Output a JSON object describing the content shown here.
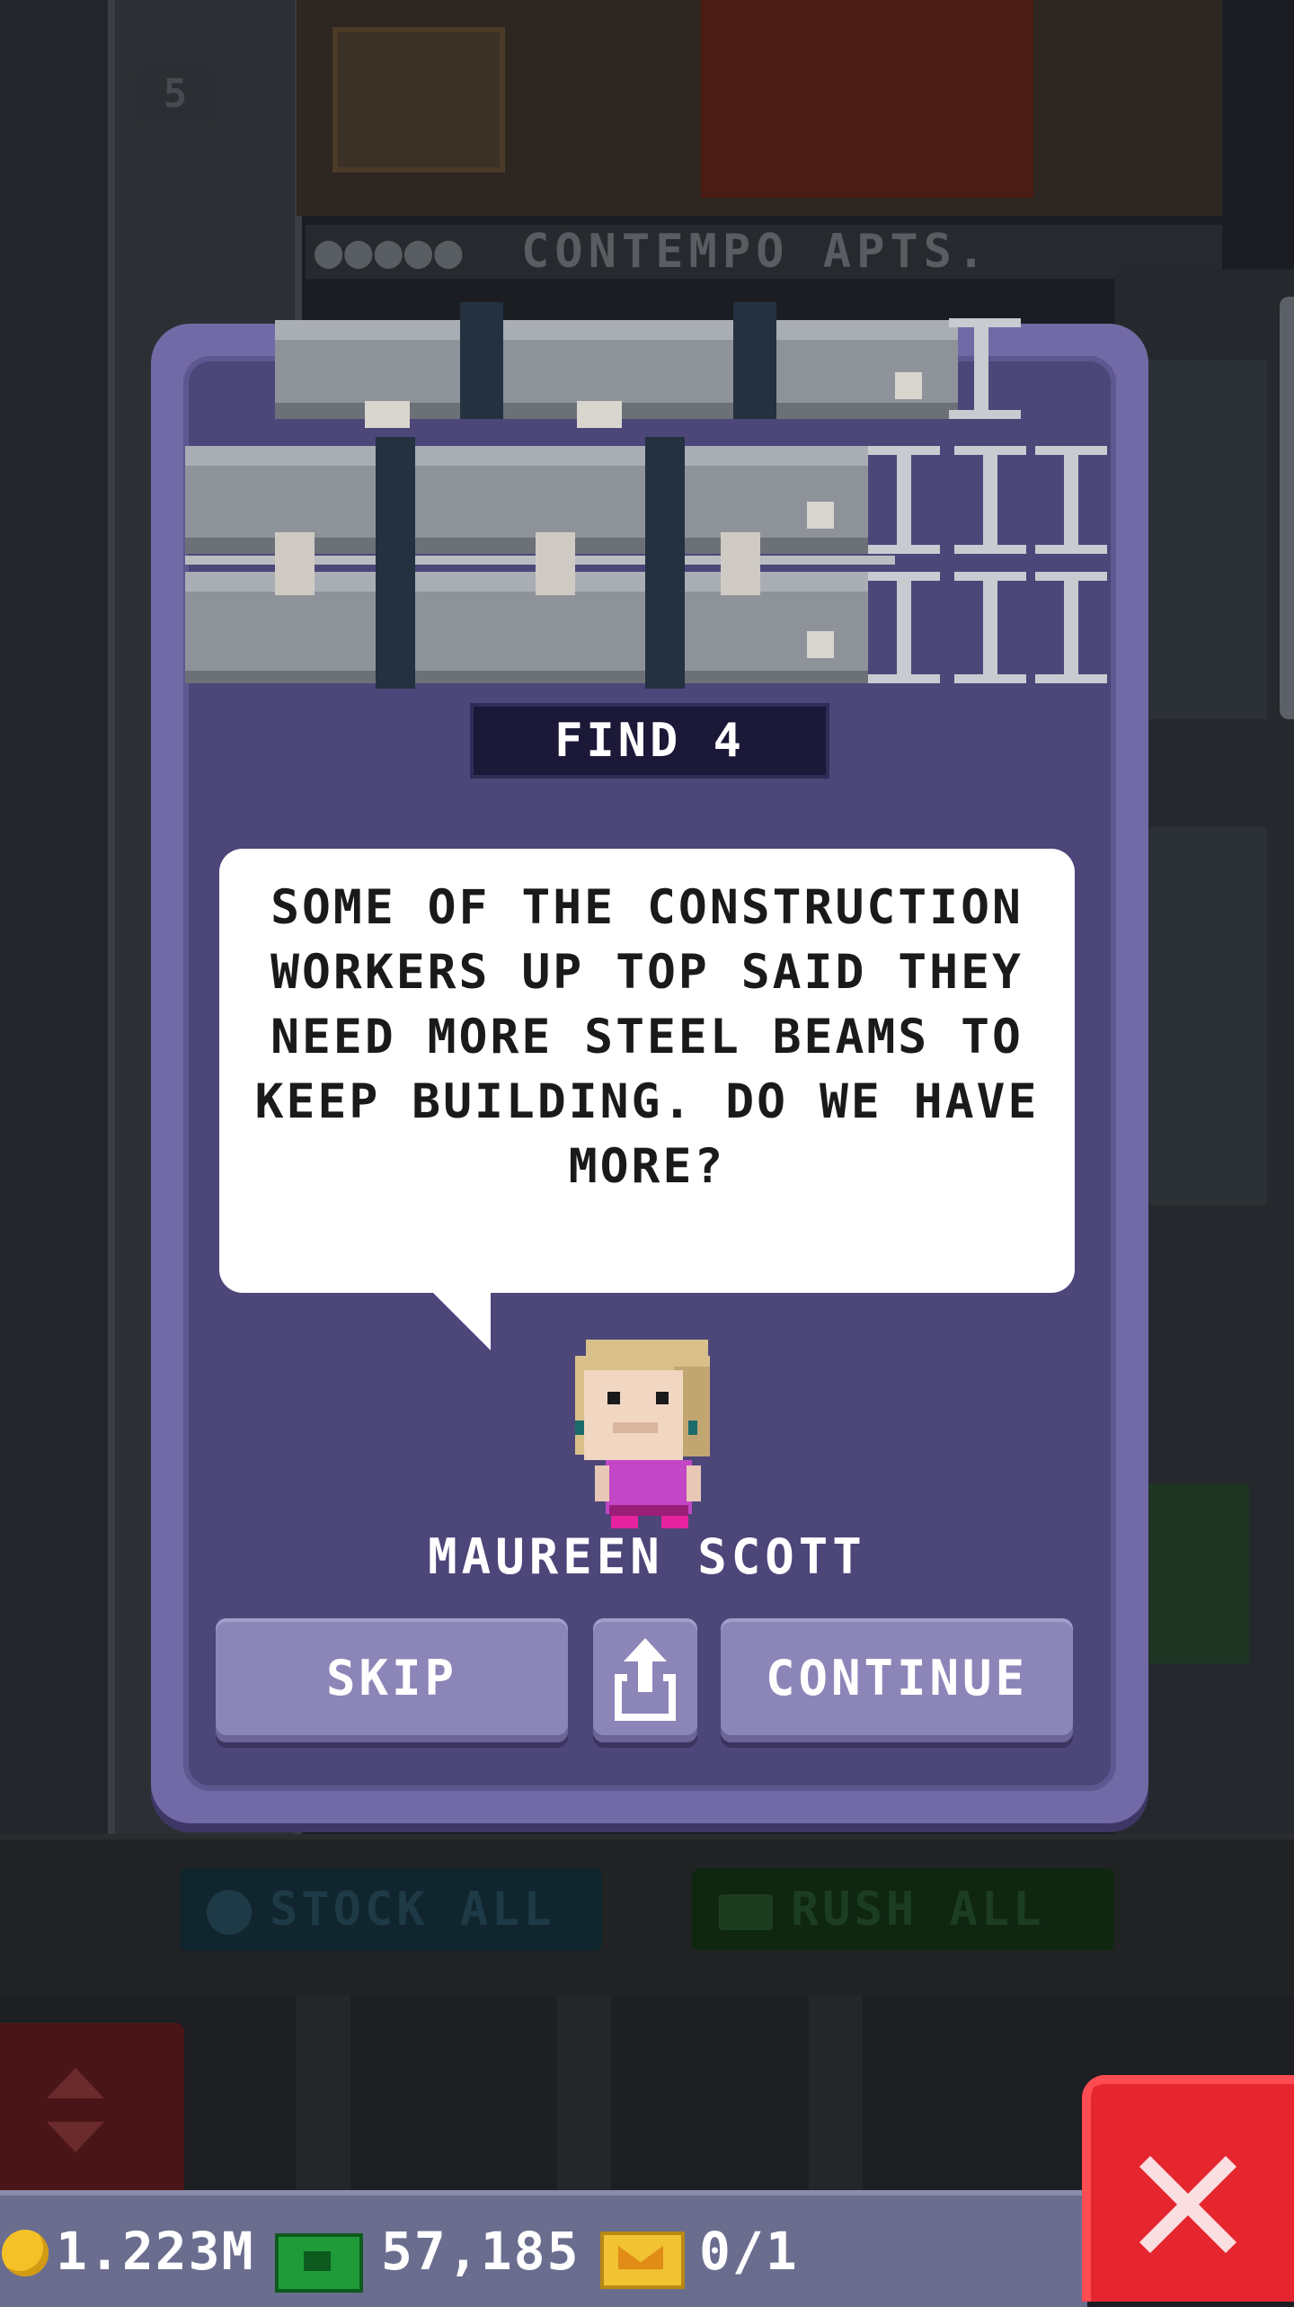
{
  "background": {
    "floor_number": "5",
    "floor_name": "CONTEMPO APTS.",
    "stock_all_label": "STOCK ALL",
    "rush_all_label": "RUSH ALL"
  },
  "mission": {
    "find_label": "FIND 4",
    "message": "SOME OF THE CONSTRUCTION WORKERS UP TOP SAID THEY NEED MORE STEEL BEAMS TO KEEP BUILDING. DO WE HAVE MORE?",
    "character_name": "MAUREEN SCOTT",
    "skip_label": "SKIP",
    "continue_label": "CONTINUE",
    "share_icon": "share-icon",
    "item_icon": "steel-beams-icon"
  },
  "status": {
    "coins": "1.223M",
    "cash": "57,185",
    "bux": "0/1"
  },
  "colors": {
    "modal_frame": "#726aa6",
    "modal_body": "#4c4679",
    "button": "#8c86b8",
    "close_button": "#e5262f"
  }
}
